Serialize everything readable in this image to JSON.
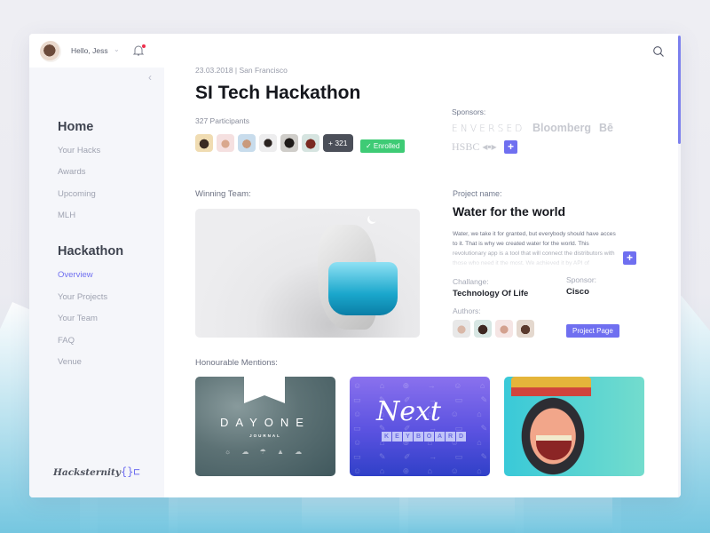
{
  "header": {
    "greeting": "Hello, Jess",
    "icons": {
      "user_avatar": "avatar",
      "dropdown": "chevron-down-icon",
      "notifications": "bell-icon",
      "search": "search-icon"
    },
    "notification_dot_color": "#ee2e4c"
  },
  "sidebar": {
    "collapse_glyph": "‹",
    "sections": [
      {
        "title": "Home",
        "items": [
          {
            "label": "Your Hacks",
            "active": false
          },
          {
            "label": "Awards",
            "active": false
          },
          {
            "label": "Upcoming",
            "active": false
          },
          {
            "label": "MLH",
            "active": false
          }
        ]
      },
      {
        "title": "Hackathon",
        "items": [
          {
            "label": "Overview",
            "active": true
          },
          {
            "label": "Your Projects",
            "active": false
          },
          {
            "label": "Your Team",
            "active": false
          },
          {
            "label": "FAQ",
            "active": false
          },
          {
            "label": "Venue",
            "active": false
          }
        ]
      }
    ],
    "brand_name": "Hacksternity",
    "brand_logo": "{}⊏"
  },
  "event": {
    "meta": "23.03.2018 | San Francisco",
    "title": "SI Tech Hackathon",
    "participants_label": "327 Participants",
    "more_participants": "+ 321",
    "enrolled_label": "✓ Enrolled"
  },
  "sponsors": {
    "label": "Sponsors:",
    "logos": [
      "ENVERSED",
      "Bloomberg",
      "Bē",
      "HSBC ◂▪▸"
    ],
    "add_glyph": "+"
  },
  "winning_team": {
    "label": "Winning Team:"
  },
  "project": {
    "name_label": "Project name:",
    "name": "Water for the world",
    "description": "Water, we take it for granted, but everybody should have acces to it. That is why we created water for the world. This revolutionary app is a tool that will connect the distributors with those who need it the most. We achieved it by API of",
    "expand_glyph": "+",
    "challenge_label": "Challange:",
    "challenge": "Technology Of Life",
    "sponsor_label": "Sponsor:",
    "sponsor": "Cisco",
    "authors_label": "Authors:",
    "project_page_button": "Project Page"
  },
  "mentions": {
    "label": "Honourable Mentions:",
    "items": [
      {
        "title": "DAYONE",
        "subtitle": "JOURNAL",
        "icons": "☼ ☁ ☂ ▲ ☁"
      },
      {
        "title": "Next",
        "subtitle": "KEYBOARD"
      },
      {
        "title": "Clash Royale King"
      }
    ]
  },
  "colors": {
    "accent": "#6f6ff0",
    "enrolled_green": "#3ecb75",
    "counter_dark": "#4b4f59"
  }
}
